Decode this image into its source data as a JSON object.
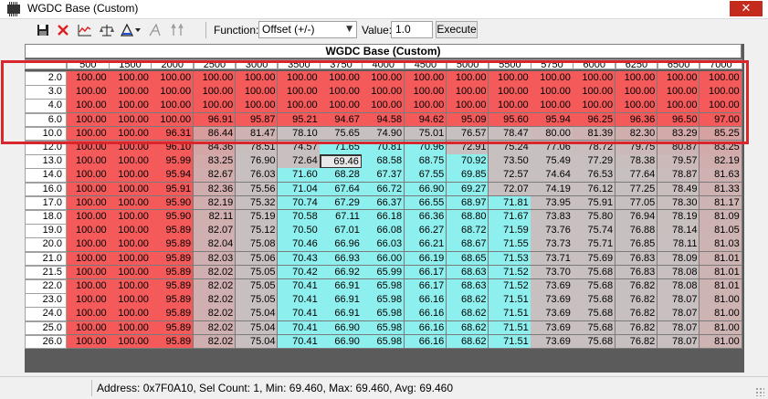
{
  "window": {
    "title": "WGDC Base (Custom)",
    "close_glyph": "✕"
  },
  "toolbar": {
    "icons": [
      "save-icon",
      "delete-icon",
      "graph-icon",
      "scale-balance-icon",
      "interpolate-icon",
      "smooth-icon",
      "flatten-icon"
    ],
    "function_label": "Function:",
    "function_value": "Offset (+/-)",
    "value_label": "Value:",
    "value": "1.0",
    "execute_label": "Execute"
  },
  "table": {
    "title": "WGDC Base (Custom)",
    "columns": [
      "500",
      "1500",
      "2000",
      "2500",
      "3000",
      "3500",
      "3750",
      "4000",
      "4500",
      "5000",
      "5500",
      "5750",
      "6000",
      "6250",
      "6500",
      "7000"
    ],
    "rows": [
      {
        "label": "2.0",
        "values": [
          "100.00",
          "100.00",
          "100.00",
          "100.00",
          "100.00",
          "100.00",
          "100.00",
          "100.00",
          "100.00",
          "100.00",
          "100.00",
          "100.00",
          "100.00",
          "100.00",
          "100.00",
          "100.00"
        ]
      },
      {
        "label": "3.0",
        "values": [
          "100.00",
          "100.00",
          "100.00",
          "100.00",
          "100.00",
          "100.00",
          "100.00",
          "100.00",
          "100.00",
          "100.00",
          "100.00",
          "100.00",
          "100.00",
          "100.00",
          "100.00",
          "100.00"
        ]
      },
      {
        "label": "4.0",
        "values": [
          "100.00",
          "100.00",
          "100.00",
          "100.00",
          "100.00",
          "100.00",
          "100.00",
          "100.00",
          "100.00",
          "100.00",
          "100.00",
          "100.00",
          "100.00",
          "100.00",
          "100.00",
          "100.00"
        ]
      },
      {
        "label": "6.0",
        "values": [
          "100.00",
          "100.00",
          "100.00",
          "96.91",
          "95.87",
          "95.21",
          "94.67",
          "94.58",
          "94.62",
          "95.09",
          "95.60",
          "95.94",
          "96.25",
          "96.36",
          "96.50",
          "97.00"
        ]
      },
      {
        "label": "10.0",
        "values": [
          "100.00",
          "100.00",
          "96.31",
          "86.44",
          "81.47",
          "78.10",
          "75.65",
          "74.90",
          "75.01",
          "76.57",
          "78.47",
          "80.00",
          "81.39",
          "82.30",
          "83.29",
          "85.25"
        ]
      },
      {
        "label": "12.0",
        "values": [
          "100.00",
          "100.00",
          "96.10",
          "84.36",
          "78.51",
          "74.57",
          "71.65",
          "70.81",
          "70.96",
          "72.91",
          "75.24",
          "77.06",
          "78.72",
          "79.75",
          "80.87",
          "83.25"
        ]
      },
      {
        "label": "13.0",
        "values": [
          "100.00",
          "100.00",
          "95.99",
          "83.25",
          "76.90",
          "72.64",
          "69.46",
          "68.58",
          "68.75",
          "70.92",
          "73.50",
          "75.49",
          "77.29",
          "78.38",
          "79.57",
          "82.19"
        ]
      },
      {
        "label": "14.0",
        "values": [
          "100.00",
          "100.00",
          "95.94",
          "82.67",
          "76.03",
          "71.60",
          "68.28",
          "67.37",
          "67.55",
          "69.85",
          "72.57",
          "74.64",
          "76.53",
          "77.64",
          "78.87",
          "81.63"
        ]
      },
      {
        "label": "16.0",
        "values": [
          "100.00",
          "100.00",
          "95.91",
          "82.36",
          "75.56",
          "71.04",
          "67.64",
          "66.72",
          "66.90",
          "69.27",
          "72.07",
          "74.19",
          "76.12",
          "77.25",
          "78.49",
          "81.33"
        ]
      },
      {
        "label": "17.0",
        "values": [
          "100.00",
          "100.00",
          "95.90",
          "82.19",
          "75.32",
          "70.74",
          "67.29",
          "66.37",
          "66.55",
          "68.97",
          "71.81",
          "73.95",
          "75.91",
          "77.05",
          "78.30",
          "81.17"
        ]
      },
      {
        "label": "18.0",
        "values": [
          "100.00",
          "100.00",
          "95.90",
          "82.11",
          "75.19",
          "70.58",
          "67.11",
          "66.18",
          "66.36",
          "68.80",
          "71.67",
          "73.83",
          "75.80",
          "76.94",
          "78.19",
          "81.09"
        ]
      },
      {
        "label": "19.0",
        "values": [
          "100.00",
          "100.00",
          "95.89",
          "82.07",
          "75.12",
          "70.50",
          "67.01",
          "66.08",
          "66.27",
          "68.72",
          "71.59",
          "73.76",
          "75.74",
          "76.88",
          "78.14",
          "81.05"
        ]
      },
      {
        "label": "20.0",
        "values": [
          "100.00",
          "100.00",
          "95.89",
          "82.04",
          "75.08",
          "70.46",
          "66.96",
          "66.03",
          "66.21",
          "68.67",
          "71.55",
          "73.73",
          "75.71",
          "76.85",
          "78.11",
          "81.03"
        ]
      },
      {
        "label": "21.0",
        "values": [
          "100.00",
          "100.00",
          "95.89",
          "82.03",
          "75.06",
          "70.43",
          "66.93",
          "66.00",
          "66.19",
          "68.65",
          "71.53",
          "73.71",
          "75.69",
          "76.83",
          "78.09",
          "81.01"
        ]
      },
      {
        "label": "21.5",
        "values": [
          "100.00",
          "100.00",
          "95.89",
          "82.02",
          "75.05",
          "70.42",
          "66.92",
          "65.99",
          "66.17",
          "68.63",
          "71.52",
          "73.70",
          "75.68",
          "76.83",
          "78.08",
          "81.01"
        ]
      },
      {
        "label": "22.0",
        "values": [
          "100.00",
          "100.00",
          "95.89",
          "82.02",
          "75.05",
          "70.41",
          "66.91",
          "65.98",
          "66.17",
          "68.63",
          "71.52",
          "73.69",
          "75.68",
          "76.82",
          "78.08",
          "81.01"
        ]
      },
      {
        "label": "23.0",
        "values": [
          "100.00",
          "100.00",
          "95.89",
          "82.02",
          "75.05",
          "70.41",
          "66.91",
          "65.98",
          "66.16",
          "68.62",
          "71.51",
          "73.69",
          "75.68",
          "76.82",
          "78.07",
          "81.00"
        ]
      },
      {
        "label": "24.0",
        "values": [
          "100.00",
          "100.00",
          "95.89",
          "82.02",
          "75.04",
          "70.41",
          "66.91",
          "65.98",
          "66.16",
          "68.62",
          "71.51",
          "73.69",
          "75.68",
          "76.82",
          "78.07",
          "81.00"
        ]
      },
      {
        "label": "25.0",
        "values": [
          "100.00",
          "100.00",
          "95.89",
          "82.02",
          "75.04",
          "70.41",
          "66.90",
          "65.98",
          "66.16",
          "68.62",
          "71.51",
          "73.69",
          "75.68",
          "76.82",
          "78.07",
          "81.00"
        ]
      },
      {
        "label": "26.0",
        "values": [
          "100.00",
          "100.00",
          "95.89",
          "82.02",
          "75.04",
          "70.41",
          "66.90",
          "65.98",
          "66.16",
          "68.62",
          "71.51",
          "73.69",
          "75.68",
          "76.82",
          "78.07",
          "81.00"
        ]
      }
    ],
    "selected": {
      "row": 6,
      "col": 6
    }
  },
  "colors": {
    "high": "#f45a5a",
    "mid": "#c8c0c0",
    "low": "#8ef0ee",
    "highlight_box": "#d9262d"
  },
  "status": {
    "text": "Address: 0x7F0A10, Sel Count: 1, Min: 69.460, Max: 69.460, Avg: 69.460"
  }
}
